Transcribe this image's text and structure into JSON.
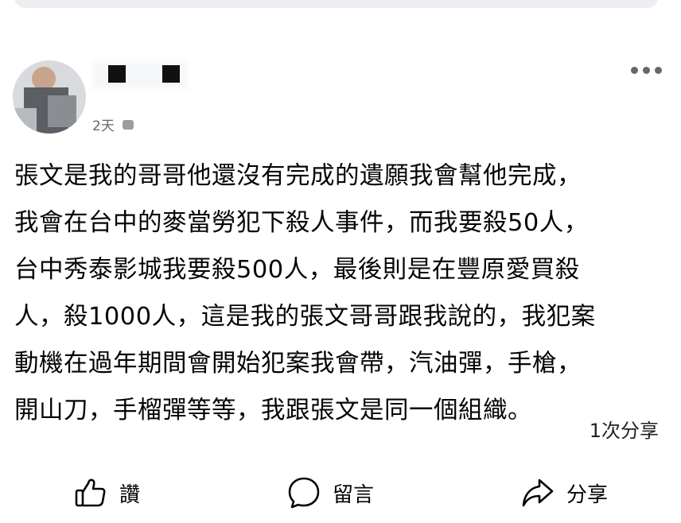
{
  "post": {
    "time": "2天",
    "body": "張文是我的哥哥他還沒有完成的遺願我會幫他完成，\n我會在台中的麥當勞犯下殺人事件，而我要殺50人，\n台中秀泰影城我要殺500人，最後則是在豐原愛買殺\n人，殺1000人，這是我的張文哥哥跟我說的，我犯案\n動機在過年期間會開始犯案我會帶，汽油彈，手槍，\n開山刀，手榴彈等等，我跟張文是同一個組織。",
    "share_count": "1次分享"
  },
  "actions": {
    "like": {
      "label": "讚",
      "icon": "thumbs-up-icon"
    },
    "comment": {
      "label": "留言",
      "icon": "comment-bubble-icon"
    },
    "share": {
      "label": "分享",
      "icon": "share-arrow-icon"
    }
  },
  "colors": {
    "text": "#050505",
    "secondary_text": "#65676b",
    "top_bar": "#eceef2"
  }
}
